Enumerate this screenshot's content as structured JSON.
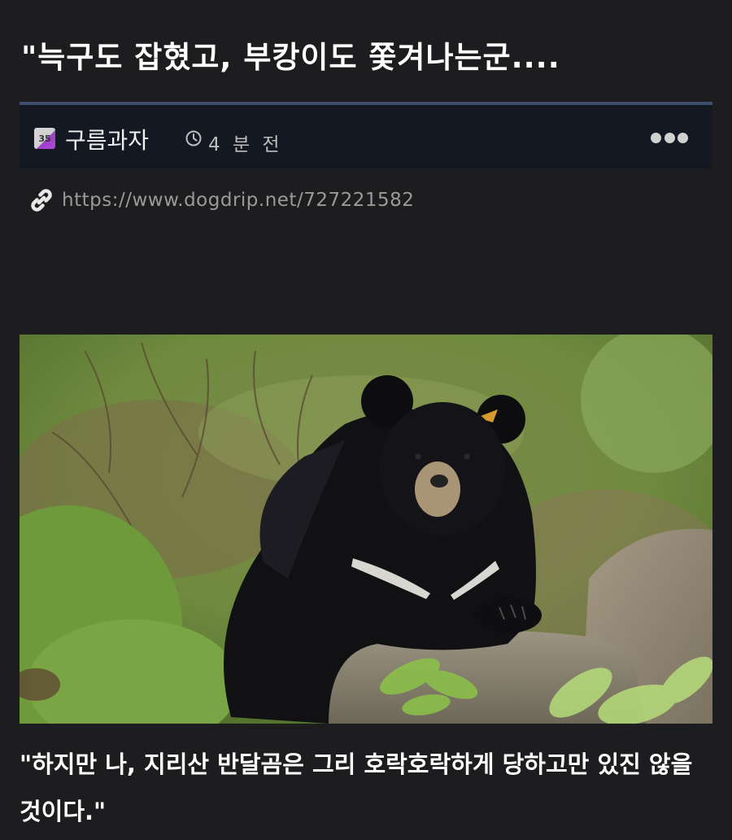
{
  "post": {
    "title": "\"늑구도 잡혔고, 부캉이도 쫓겨나는군....",
    "level_badge": "35",
    "author": "구름과자",
    "time": "4 분 전",
    "url": "https://www.dogdrip.net/727221582",
    "caption": "\"하지만 나, 지리산 반달곰은 그리 호락호락하게 당하고만 있진 않을 것이다.\""
  },
  "icons": {
    "clock": "clock-icon",
    "more": "more-options-icon",
    "link": "link-icon"
  },
  "colors": {
    "background": "#1d1d1f",
    "meta_bar": "#141822",
    "meta_border": "#3d4d6d",
    "url_text": "#9a9a9a"
  }
}
